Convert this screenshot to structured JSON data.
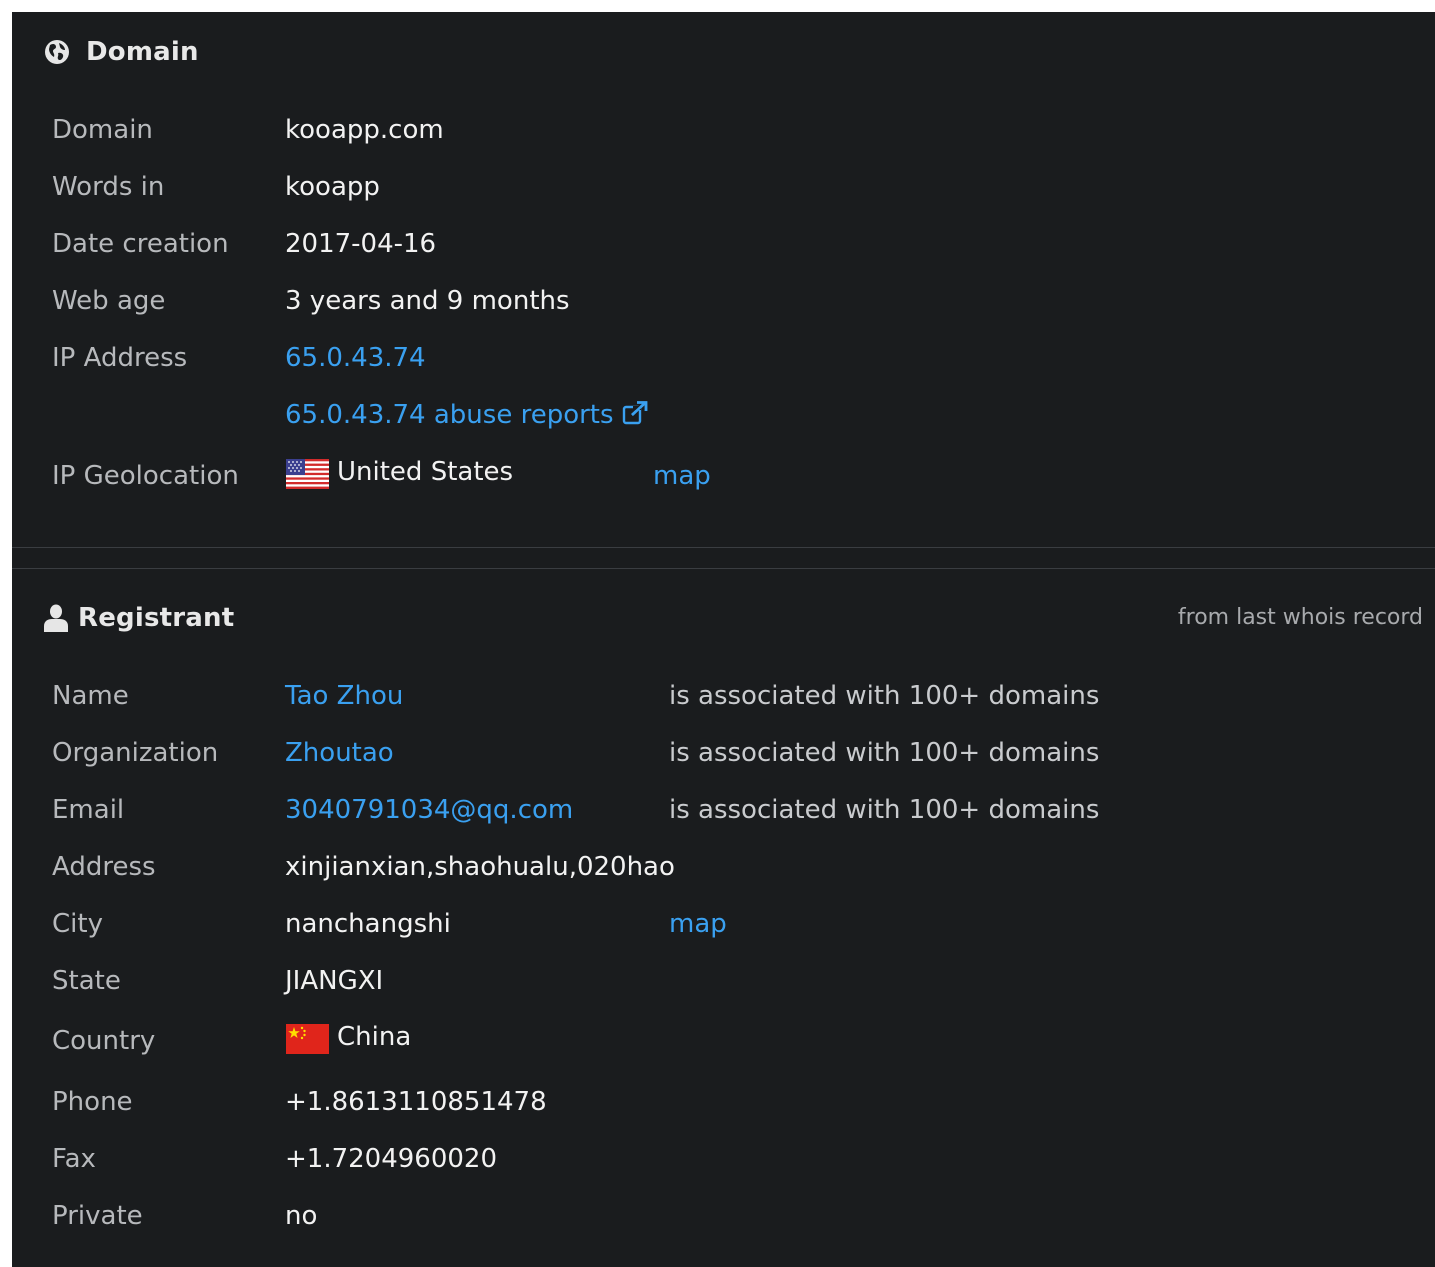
{
  "colors": {
    "background": "#1a1c1e",
    "label": "#b7b9bc",
    "value": "#f2f2f2",
    "link": "#3aa0f0",
    "divider": "#3a3d41"
  },
  "domain_section": {
    "title": "Domain",
    "icon": "globe-icon",
    "rows": {
      "domain": {
        "label": "Domain",
        "value": "kooapp.com"
      },
      "words_in": {
        "label": "Words in",
        "value": "kooapp"
      },
      "date_creation": {
        "label": "Date creation",
        "value": "2017-04-16"
      },
      "web_age": {
        "label": "Web age",
        "value": "3 years and 9 months"
      },
      "ip_address": {
        "label": "IP Address",
        "value": "65.0.43.74"
      },
      "abuse_reports": {
        "label": "",
        "value": "65.0.43.74 abuse reports"
      },
      "ip_geolocation": {
        "label": "IP Geolocation",
        "value": "United States",
        "map": "map",
        "flag": "us-flag-icon"
      }
    }
  },
  "registrant_section": {
    "title": "Registrant",
    "icon": "user-icon",
    "note": "from last whois record",
    "rows": {
      "name": {
        "label": "Name",
        "value": "Tao Zhou",
        "assoc": "is associated with 100+ domains"
      },
      "organization": {
        "label": "Organization",
        "value": "Zhoutao",
        "assoc": "is associated with 100+ domains"
      },
      "email": {
        "label": "Email",
        "value": "3040791034@qq.com",
        "assoc": "is associated with 100+ domains"
      },
      "address": {
        "label": "Address",
        "value": "xinjianxian,shaohualu,020hao"
      },
      "city": {
        "label": "City",
        "value": "nanchangshi",
        "map": "map"
      },
      "state": {
        "label": "State",
        "value": "JIANGXI"
      },
      "country": {
        "label": "Country",
        "value": "China",
        "flag": "cn-flag-icon"
      },
      "phone": {
        "label": "Phone",
        "value": "+1.8613110851478"
      },
      "fax": {
        "label": "Fax",
        "value": "+1.7204960020"
      },
      "private": {
        "label": "Private",
        "value": "no"
      }
    }
  }
}
